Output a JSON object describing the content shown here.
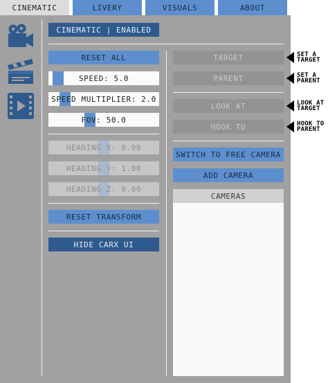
{
  "tabs": [
    {
      "label": "CINEMATIC",
      "active": true
    },
    {
      "label": "LIVERY",
      "active": false
    },
    {
      "label": "VISUALS",
      "active": false
    },
    {
      "label": "ABOUT",
      "active": false
    }
  ],
  "sidebar": {
    "icons": [
      "video-camera-icon",
      "clapperboard-icon",
      "film-play-icon"
    ]
  },
  "status": {
    "label": "CINEMATIC | ENABLED"
  },
  "left": {
    "reset_all": "RESET ALL",
    "speed": {
      "label": "SPEED: 5.0",
      "fraction": 0.05
    },
    "speed_multiplier": {
      "label": "SPEED MULTIPLIER: 2.0",
      "fraction": 0.1
    },
    "fov": {
      "label": "FOV: 50.0",
      "fraction": 0.33
    },
    "heading_x": {
      "label": "HEADING X: 0.00",
      "fraction": 0.5
    },
    "heading_y": {
      "label": "HEADING Y: 1.00",
      "fraction": 0.5
    },
    "heading_z": {
      "label": "HEADING Z: 0.00",
      "fraction": 0.5
    },
    "reset_transform": "RESET TRANSFORM",
    "hide_ui": "HIDE CARX UI"
  },
  "right": {
    "target": "TARGET",
    "parent": "PARENT",
    "look_at": "LOOK AT",
    "hook_to": "HOOK TO",
    "free_camera": "SWITCH TO FREE CAMERA",
    "add_camera": "ADD CAMERA",
    "cameras_header": "CAMERAS"
  },
  "hints": {
    "set_target": [
      "SET A",
      "TARGET"
    ],
    "set_parent": [
      "SET A",
      "PARENT"
    ],
    "look_at_target": [
      "LOOK AT",
      "TARGET"
    ],
    "hook_to_parent": [
      "HOOK TO",
      "PARENT"
    ]
  },
  "colors": {
    "accent": "#5d8fcf",
    "accent_dark": "#2f5a8e",
    "panel": "#a1a1a1",
    "tab_active": "#dcdcdc"
  }
}
